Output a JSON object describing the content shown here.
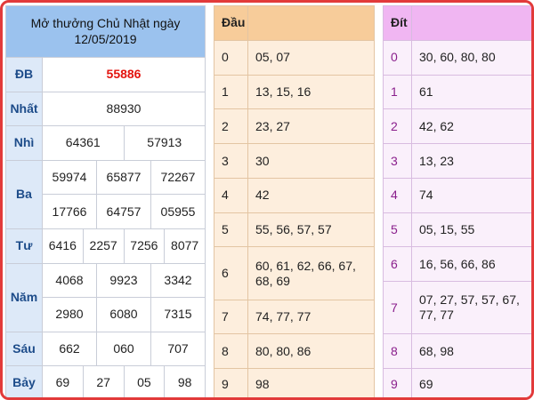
{
  "results": {
    "title_line1": "Mở thưởng Chủ Nhật ngày",
    "title_line2": "12/05/2019",
    "rows": {
      "db": {
        "label": "ĐB",
        "values": [
          "55886"
        ]
      },
      "nhat": {
        "label": "Nhất",
        "values": [
          "88930"
        ]
      },
      "nhi": {
        "label": "Nhì",
        "values": [
          "64361",
          "57913"
        ]
      },
      "ba": {
        "label": "Ba",
        "values": [
          "59974",
          "65877",
          "72267",
          "17766",
          "64757",
          "05955"
        ]
      },
      "tu": {
        "label": "Tư",
        "values": [
          "6416",
          "2257",
          "7256",
          "8077"
        ]
      },
      "nam": {
        "label": "Năm",
        "values": [
          "4068",
          "9923",
          "3342",
          "2980",
          "6080",
          "7315"
        ]
      },
      "sau": {
        "label": "Sáu",
        "values": [
          "662",
          "060",
          "707"
        ]
      },
      "bay": {
        "label": "Bảy",
        "values": [
          "69",
          "27",
          "05",
          "98"
        ]
      }
    }
  },
  "dau": {
    "header": "Đầu",
    "rows": [
      {
        "k": "0",
        "v": "05, 07"
      },
      {
        "k": "1",
        "v": "13, 15, 16"
      },
      {
        "k": "2",
        "v": "23, 27"
      },
      {
        "k": "3",
        "v": "30"
      },
      {
        "k": "4",
        "v": "42"
      },
      {
        "k": "5",
        "v": "55, 56, 57, 57"
      },
      {
        "k": "6",
        "v": "60, 61, 62, 66, 67, 68, 69"
      },
      {
        "k": "7",
        "v": "74, 77, 77"
      },
      {
        "k": "8",
        "v": "80, 80, 86"
      },
      {
        "k": "9",
        "v": "98"
      }
    ]
  },
  "dit": {
    "header": "Đít",
    "rows": [
      {
        "k": "0",
        "v": "30, 60, 80, 80"
      },
      {
        "k": "1",
        "v": "61"
      },
      {
        "k": "2",
        "v": "42, 62"
      },
      {
        "k": "3",
        "v": "13, 23"
      },
      {
        "k": "4",
        "v": "74"
      },
      {
        "k": "5",
        "v": "05, 15, 55"
      },
      {
        "k": "6",
        "v": "16, 56, 66, 86"
      },
      {
        "k": "7",
        "v": "07, 27, 57, 57, 67, 77, 77"
      },
      {
        "k": "8",
        "v": "68, 98"
      },
      {
        "k": "9",
        "v": "69"
      }
    ]
  },
  "colors": {
    "frame_border": "#e23a3a",
    "special_prize": "#e3140f",
    "results_header": "#9bc2ee",
    "dau_header": "#f7cc9a",
    "dit_header": "#f0b6f2"
  }
}
